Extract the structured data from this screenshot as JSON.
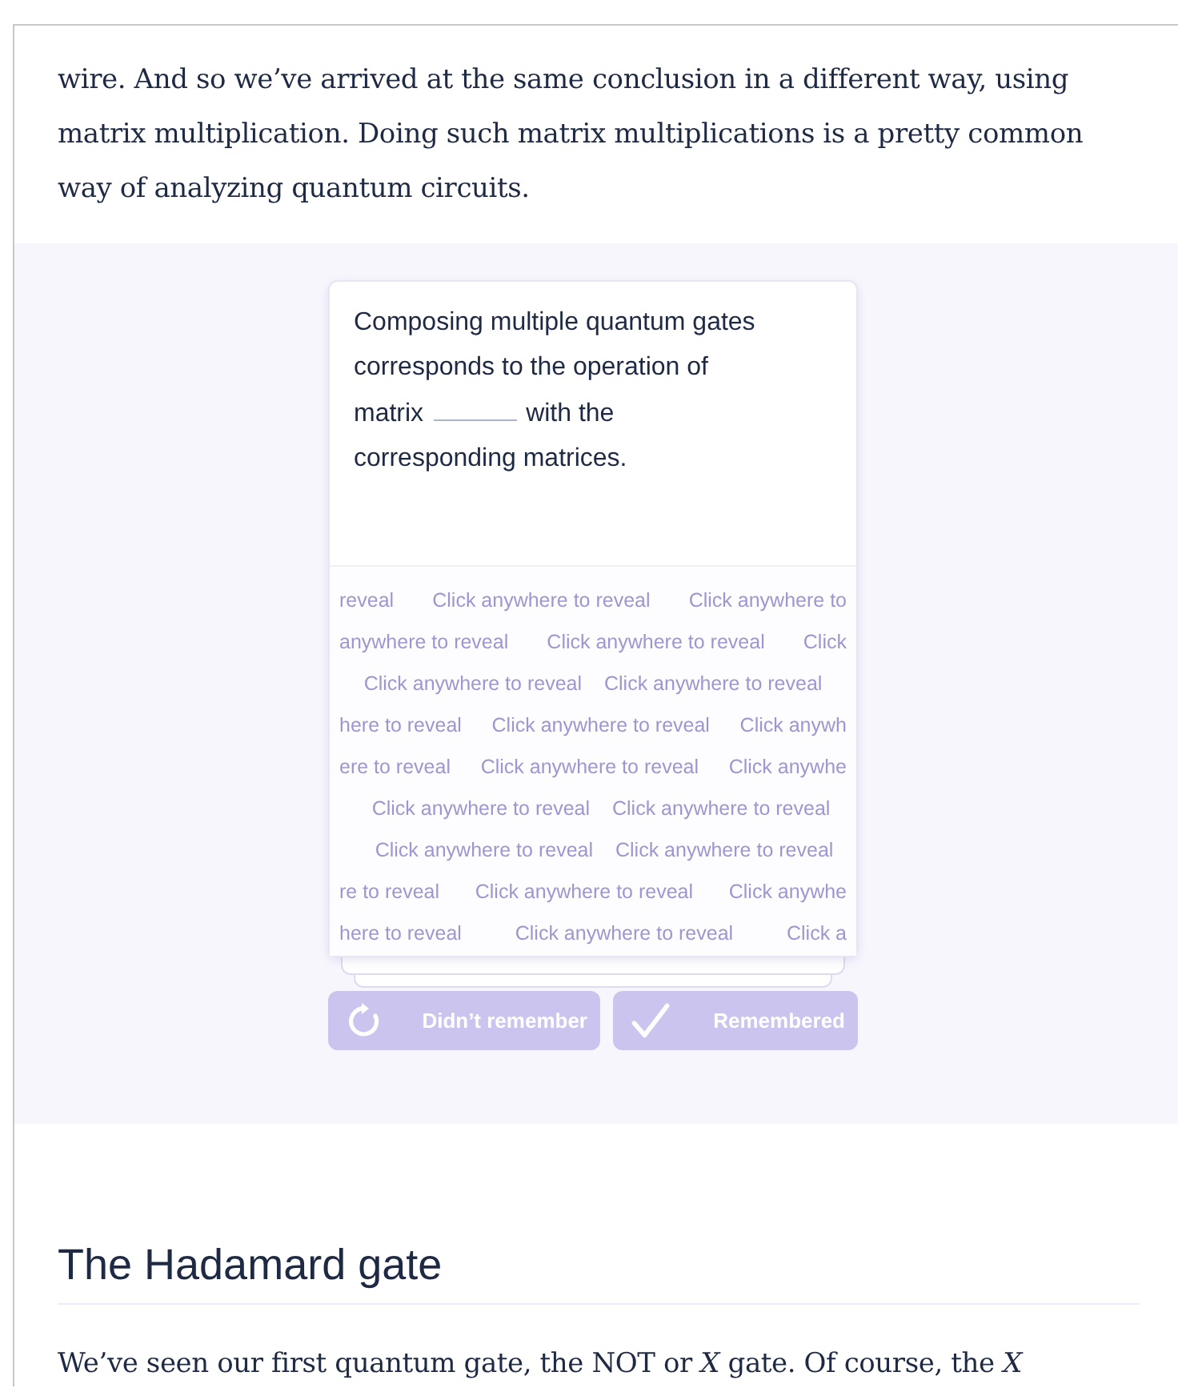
{
  "article": {
    "paragraph": "wire. And so we’ve arrived at the same conclusion in a different way, using matrix multiplication. Doing such matrix multiplications is a pretty common way of analyzing quantum circuits."
  },
  "flashcard": {
    "prompt_lines": [
      "Composing multiple quantum gates corresponds to the operation of",
      "matrix",
      "with the",
      "corresponding matrices."
    ],
    "reveal_rows": [
      [
        "reveal",
        "Click anywhere to reveal",
        "Click anywhere to"
      ],
      [
        "anywhere to reveal",
        "Click anywhere to reveal",
        "Click"
      ],
      [
        "Click anywhere to reveal",
        "Click anywhere to reveal"
      ],
      [
        "here to reveal",
        "Click anywhere to reveal",
        "Click anywh"
      ],
      [
        "ere to reveal",
        "Click anywhere to reveal",
        "Click anywhe"
      ],
      [
        "Click anywhere to reveal",
        "Click anywhere to reveal"
      ],
      [
        "Click anywhere to reveal",
        "Click anywhere to reveal"
      ],
      [
        "re to reveal",
        "Click anywhere to reveal",
        "Click anywhe"
      ],
      [
        "here to reveal",
        "Click anywhere to reveal",
        "Click a"
      ]
    ],
    "buttons": [
      {
        "kind": "retry",
        "label": "Didn’t remember",
        "disabled": true
      },
      {
        "kind": "check",
        "label": "Remembered",
        "disabled": true
      }
    ]
  },
  "section": {
    "heading": "The Hadamard gate",
    "paragraph": "We’ve seen our first quantum gate, the NOT or *X* gate. Of course, the *X*"
  }
}
